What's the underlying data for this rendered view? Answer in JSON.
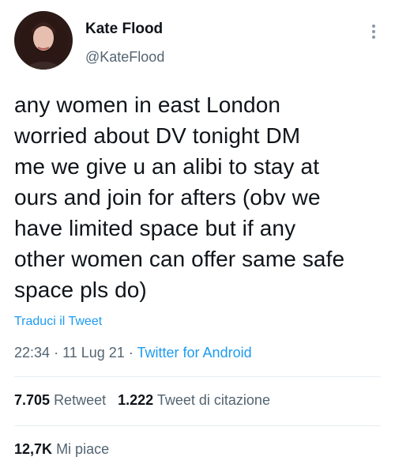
{
  "author": {
    "name": "Kate Flood",
    "handle": "@KateFlood"
  },
  "tweet": {
    "lines": [
      "any women in east London",
      "worried about DV tonight DM",
      "me we give u an alibi to stay at",
      "ours and join for afters (obv we",
      "have limited space but if any",
      "other women can offer same safe",
      "space pls do)"
    ],
    "translate_label": "Traduci il Tweet",
    "time": "22:34",
    "date": "11 Lug 21",
    "separator": "·",
    "source": "Twitter for Android"
  },
  "stats": {
    "retweets": {
      "count": "7.705",
      "label": "Retweet"
    },
    "quotes": {
      "count": "1.222",
      "label": "Tweet di citazione"
    },
    "likes": {
      "count": "12,7K",
      "label": "Mi piace"
    }
  },
  "icons": {
    "more": "more-vertical-icon"
  },
  "colors": {
    "link": "#1d9bf0",
    "secondary_text": "#536471",
    "primary_text": "#0f1419"
  }
}
